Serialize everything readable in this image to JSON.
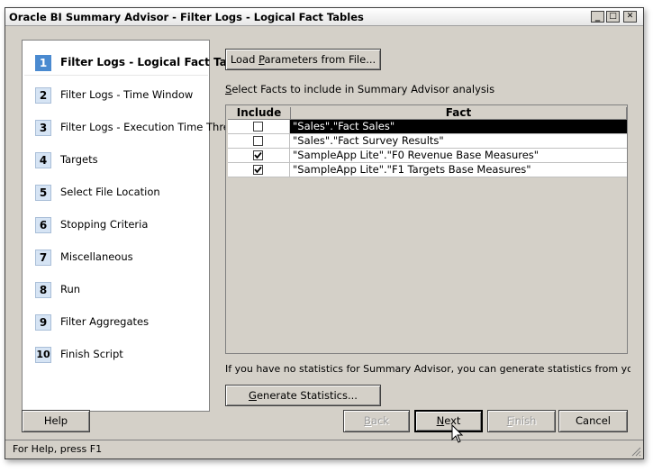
{
  "window": {
    "title": "Oracle BI Summary Advisor - Filter Logs - Logical Fact Tables",
    "controls": {
      "minimize": "_",
      "maximize": "□",
      "close": "✕"
    }
  },
  "steps": [
    {
      "num": "1",
      "label": "Filter Logs - Logical Fact Tab",
      "active": true
    },
    {
      "num": "2",
      "label": "Filter Logs - Time Window"
    },
    {
      "num": "3",
      "label": "Filter Logs - Execution Time Thresh"
    },
    {
      "num": "4",
      "label": "Targets"
    },
    {
      "num": "5",
      "label": "Select File Location"
    },
    {
      "num": "6",
      "label": "Stopping Criteria"
    },
    {
      "num": "7",
      "label": "Miscellaneous"
    },
    {
      "num": "8",
      "label": "Run"
    },
    {
      "num": "9",
      "label": "Filter Aggregates"
    },
    {
      "num": "10",
      "label": "Finish Script"
    }
  ],
  "main": {
    "load_button": {
      "pre": "Load ",
      "accel": "P",
      "post": "arameters from File..."
    },
    "instruction": {
      "accel": "S",
      "post": "elect Facts to include in Summary Advisor analysis"
    },
    "table": {
      "columns": [
        "Include",
        "Fact"
      ],
      "rows": [
        {
          "include": false,
          "fact": "\"Sales\".\"Fact Sales\"",
          "selected": true
        },
        {
          "include": false,
          "fact": "\"Sales\".\"Fact Survey Results\""
        },
        {
          "include": true,
          "fact": "\"SampleApp Lite\".\"F0 Revenue Base Measures\""
        },
        {
          "include": true,
          "fact": "\"SampleApp Lite\".\"F1 Targets Base Measures\""
        }
      ]
    },
    "stats_note": "If you have no statistics for Summary Advisor, you can generate statistics from your Usage Trac",
    "generate_button": {
      "accel": "G",
      "post": "enerate Statistics..."
    }
  },
  "footer": {
    "help": "Help",
    "back": {
      "accel": "B",
      "post": "ack"
    },
    "next": {
      "accel": "N",
      "post": "ext"
    },
    "finish": {
      "accel": "F",
      "post": "inish"
    },
    "cancel": "Cancel"
  },
  "status": "For Help, press F1",
  "colors": {
    "active_step": "#4a8ad0",
    "step_badge": "#d6e4f4",
    "selected_row": "#000000"
  }
}
